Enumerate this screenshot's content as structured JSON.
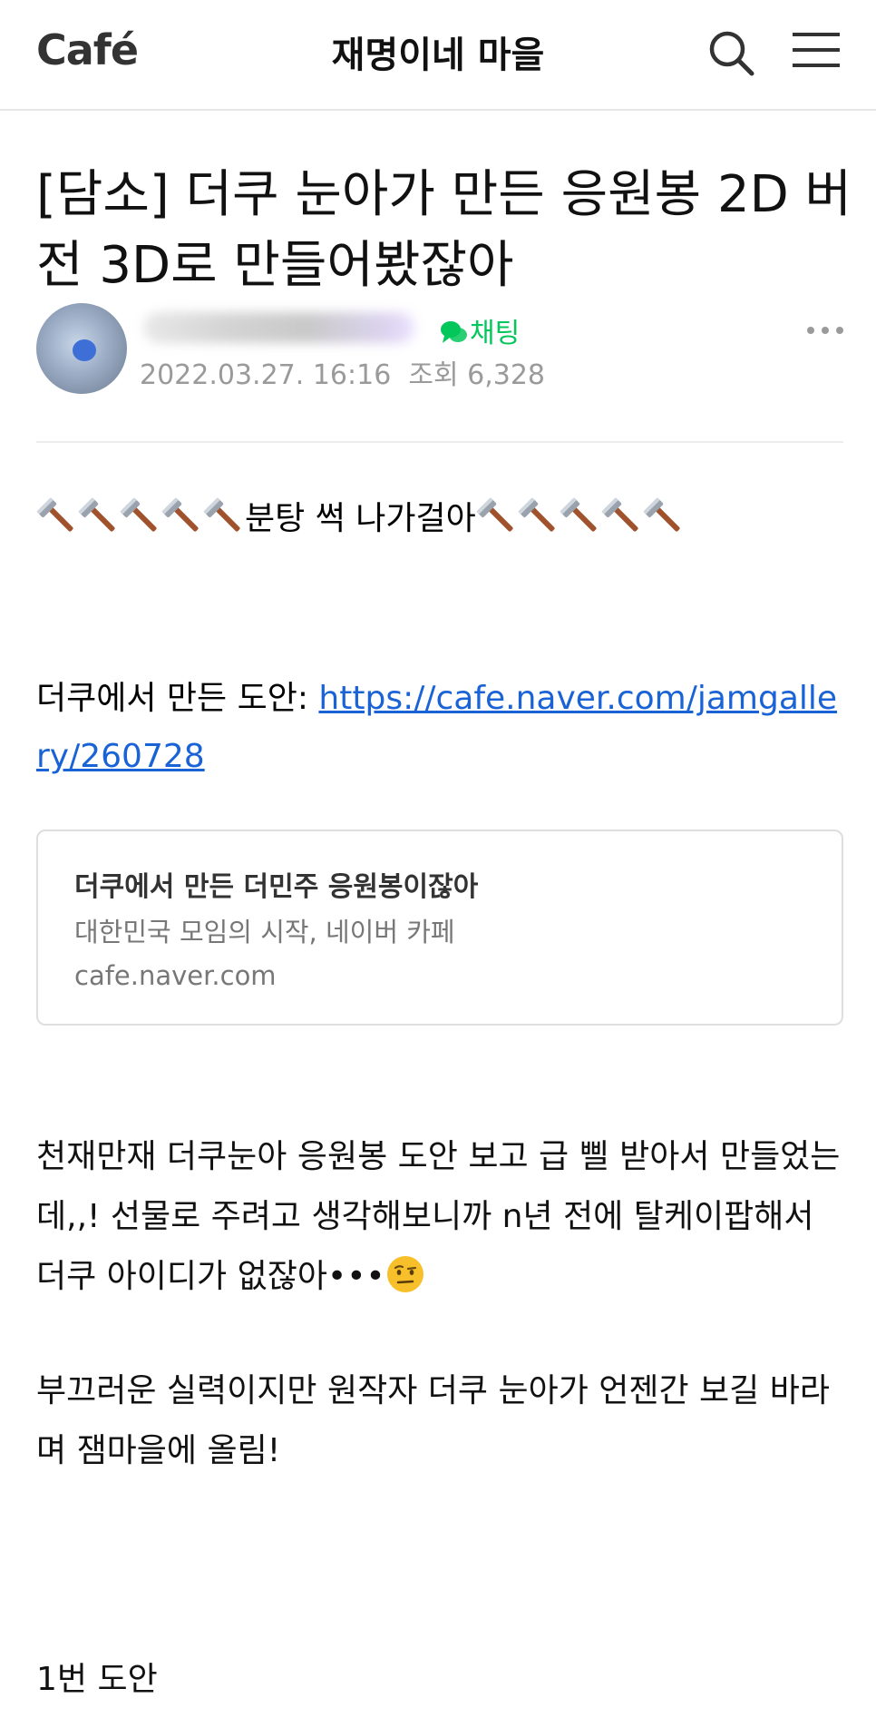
{
  "header": {
    "logo": "Café",
    "cafe_name": "재명이네 마을",
    "search_icon": "search-icon",
    "menu_icon": "hamburger-menu-icon"
  },
  "post": {
    "title": "[담소] 더쿠 눈아가 만든 응원봉 2D 버전 3D로 만들어봤잖아",
    "author": {
      "chat_label": "채팅",
      "date": "2022.03.27. 16:16",
      "views": "조회 6,328"
    },
    "body": {
      "hammer_line_text": "분탕 썩 나가걸아",
      "hammer_emoji_count_each_side": 5,
      "link_prefix": "더쿠에서 만든 도안: ",
      "link_url": "https://cafe.naver.com/jamgallery/260728",
      "og_card": {
        "title": "더쿠에서 만든 더민주 응원봉이잖아",
        "description": "대한민국 모임의 시작, 네이버 카페",
        "domain": "cafe.naver.com"
      },
      "paragraph1": "천재만재 더쿠눈아 응원봉 도안 보고 급 삘 받아서 만들었는데,,! 선물로 주려고 생각해보니까 n년 전에 탈케이팝해서 더쿠 아이디가 없잖아•••",
      "paragraph2": "부끄러운 실력이지만 원작자 더쿠 눈아가 언젠간 보길 바라며 잼마을에 올림!",
      "section_label": "1번 도안"
    }
  },
  "colors": {
    "accent_green": "#03c75a",
    "link_blue": "#1a63d6"
  }
}
